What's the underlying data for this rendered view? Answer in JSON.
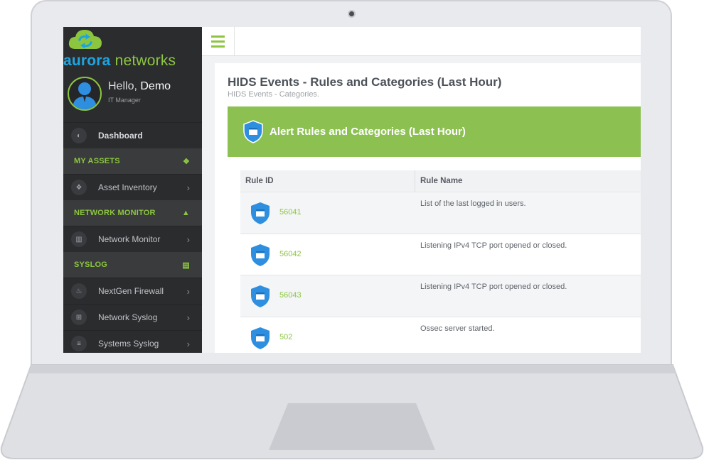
{
  "sidebar": {
    "brand_part1": "aurora",
    "brand_part2": "networks",
    "greeting": "Hello,",
    "user_name": "Demo",
    "user_role": "IT Manager",
    "nav": [
      {
        "type": "item",
        "label": "Dashboard",
        "icon": "palette-icon"
      },
      {
        "type": "section",
        "label": "MY ASSETS",
        "icon": "cubes-icon"
      },
      {
        "type": "item",
        "label": "Asset Inventory",
        "icon": "cubes-icon"
      },
      {
        "type": "section",
        "label": "NETWORK MONITOR",
        "icon": "area-chart-icon"
      },
      {
        "type": "item",
        "label": "Network Monitor",
        "icon": "bar-chart-icon"
      },
      {
        "type": "section",
        "label": "SYSLOG",
        "icon": "file-icon"
      },
      {
        "type": "item",
        "label": "NextGen Firewall",
        "icon": "fire-icon"
      },
      {
        "type": "item",
        "label": "Network Syslog",
        "icon": "sitemap-icon"
      },
      {
        "type": "item",
        "label": "Systems Syslog",
        "icon": "list-icon"
      }
    ]
  },
  "page": {
    "title": "HIDS Events - Rules and Categories (Last Hour)",
    "subtitle": "HIDS Events - Categories."
  },
  "panel": {
    "title": "Alert Rules and Categories (Last Hour)"
  },
  "table": {
    "headers": [
      "Rule ID",
      "Rule Name"
    ],
    "rows": [
      {
        "id": "56041",
        "name": "List of the last logged in users."
      },
      {
        "id": "56042",
        "name": "Listening IPv4 TCP port opened or closed."
      },
      {
        "id": "56043",
        "name": "Listening IPv4 TCP port opened or closed."
      },
      {
        "id": "502",
        "name": "Ossec server started."
      }
    ]
  },
  "colors": {
    "accent_green": "#8cc63f",
    "brand_blue": "#1ea5e0",
    "shield_blue": "#2e8fe0",
    "sidebar_bg": "#2b2c2e"
  }
}
